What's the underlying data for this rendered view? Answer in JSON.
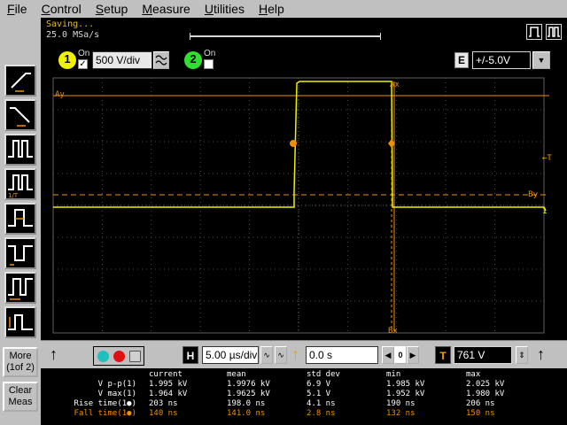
{
  "menu": [
    "File",
    "Control",
    "Setup",
    "Measure",
    "Utilities",
    "Help"
  ],
  "status": {
    "saving": "Saving...",
    "sample_rate": "25.0 MSa/s"
  },
  "channel1": {
    "number": "1",
    "on_label": "On",
    "checked": "✓",
    "scale": "500 V/div",
    "color": "#f0f000"
  },
  "channel2": {
    "number": "2",
    "on_label": "On",
    "color": "#30e030"
  },
  "range": {
    "e_label": "E",
    "value": "+/-5.0V"
  },
  "scope": {
    "marker_ay": "Ay",
    "marker_by": "By",
    "marker_t": "←T",
    "marker_ax": "Ax",
    "marker_bx": "Bx",
    "marker_1": "1",
    "trace_color": "#f0f000",
    "marker_color": "#f09000"
  },
  "horizontal": {
    "h_label": "H",
    "timebase": "5.00 µs/div",
    "delay": "0.0 s",
    "t_label": "T",
    "trigger_level": "761 V"
  },
  "side_buttons": {
    "more": "More\n(1of 2)",
    "clear": "Clear\nMeas"
  },
  "measurements": {
    "headers": [
      "current",
      "mean",
      "std dev",
      "min",
      "max"
    ],
    "rows": [
      {
        "label": "V p-p(1)",
        "values": [
          "1.995 kV",
          "1.9976 kV",
          "6.9 V",
          "1.985 kV",
          "2.025 kV"
        ],
        "color": "#ffffff"
      },
      {
        "label": "V max(1)",
        "values": [
          "1.964 kV",
          "1.9625 kV",
          "5.1 V",
          "1.952 kV",
          "1.980 kV"
        ],
        "color": "#ffffff"
      },
      {
        "label": "Rise time(1●)",
        "values": [
          "203 ns",
          "198.0 ns",
          "4.1 ns",
          "190 ns",
          "206 ns"
        ],
        "color": "#ffffff"
      },
      {
        "label": "Fall time(1●)",
        "values": [
          "140 ns",
          "141.0 ns",
          "2.8 ns",
          "132 ns",
          "150 ns"
        ],
        "color": "#f09000"
      }
    ]
  }
}
